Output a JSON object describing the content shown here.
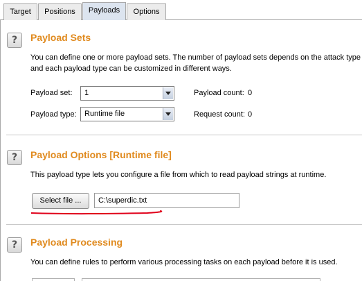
{
  "tabs": [
    {
      "label": "Target"
    },
    {
      "label": "Positions"
    },
    {
      "label": "Payloads"
    },
    {
      "label": "Options"
    }
  ],
  "active_tab": "Payloads",
  "payload_sets": {
    "title": "Payload Sets",
    "help": "?",
    "desc_line1": "You can define one or more payload sets. The number of payload sets depends on the attack type d",
    "desc_line2": "and each payload type can be customized in different ways.",
    "payload_set_label": "Payload set:",
    "payload_set_value": "1",
    "payload_type_label": "Payload type:",
    "payload_type_value": "Runtime file",
    "payload_count_label": "Payload count:",
    "payload_count_value": "0",
    "request_count_label": "Request count:",
    "request_count_value": "0"
  },
  "payload_options": {
    "title": "Payload Options [Runtime file]",
    "help": "?",
    "desc": "This payload type lets you configure a file from which to read payload strings at runtime.",
    "select_file_label": "Select file ...",
    "file_path": "C:\\superdic.txt",
    "underline_color": "#e0001a"
  },
  "payload_processing": {
    "title": "Payload Processing",
    "help": "?",
    "desc": "You can define rules to perform various processing tasks on each payload before it is used."
  },
  "colors": {
    "section_title": "#e08a1e",
    "active_tab": "#dce4ef"
  }
}
